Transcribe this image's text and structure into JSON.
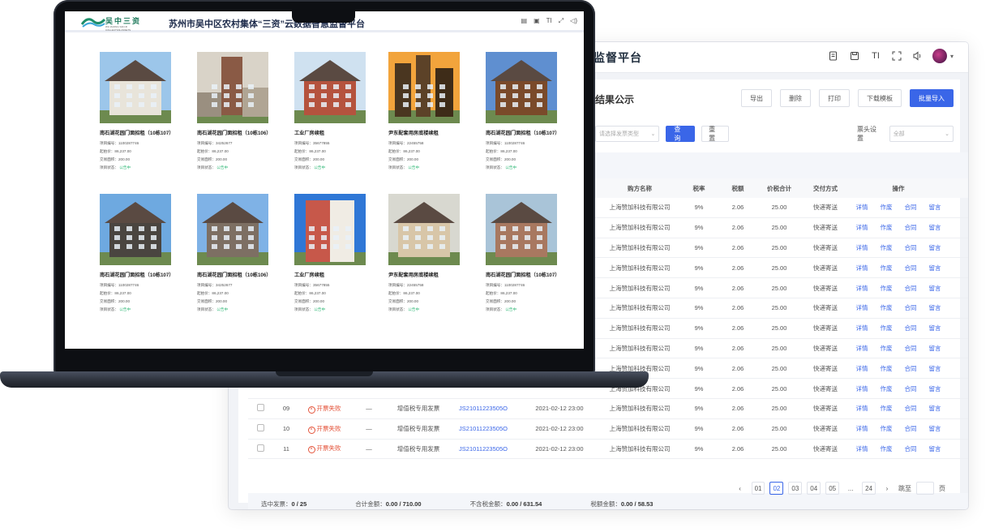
{
  "dashboard": {
    "title": "监督平台",
    "section_title": "结果公示",
    "toolbar": [
      "导出",
      "删除",
      "打印",
      "下载模板",
      "批量导入"
    ],
    "filter": {
      "select1_placeholder": "请选择发票类型",
      "query_label": "查询",
      "reset_label": "重置",
      "buyer_label": "票头设置",
      "buyer_placeholder": "全部"
    },
    "columns": [
      "",
      "",
      "",
      "",
      "",
      "",
      "",
      "购方名称",
      "税率",
      "税额",
      "价税合计",
      "交付方式",
      "操作"
    ],
    "rows": [
      {
        "no": "",
        "status": "",
        "type": "",
        "inv": "",
        "date": "",
        "buyer": "上海赞加科技有限公司",
        "rate": "9%",
        "tax": "2.06",
        "total": "25.00",
        "deliv": "快递寄送"
      },
      {
        "no": "",
        "status": "",
        "type": "",
        "inv": "",
        "date": "",
        "buyer": "上海赞加科技有限公司",
        "rate": "9%",
        "tax": "2.06",
        "total": "25.00",
        "deliv": "快递寄送"
      },
      {
        "no": "",
        "status": "",
        "type": "",
        "inv": "",
        "date": "",
        "buyer": "上海赞加科技有限公司",
        "rate": "9%",
        "tax": "2.06",
        "total": "25.00",
        "deliv": "快递寄送"
      },
      {
        "no": "",
        "status": "",
        "type": "",
        "inv": "",
        "date": "",
        "buyer": "上海赞加科技有限公司",
        "rate": "9%",
        "tax": "2.06",
        "total": "25.00",
        "deliv": "快递寄送"
      },
      {
        "no": "",
        "status": "",
        "type": "",
        "inv": "",
        "date": "",
        "buyer": "上海赞加科技有限公司",
        "rate": "9%",
        "tax": "2.06",
        "total": "25.00",
        "deliv": "快递寄送"
      },
      {
        "no": "",
        "status": "",
        "type": "",
        "inv": "",
        "date": "",
        "buyer": "上海赞加科技有限公司",
        "rate": "9%",
        "tax": "2.06",
        "total": "25.00",
        "deliv": "快递寄送"
      },
      {
        "no": "",
        "status": "",
        "type": "",
        "inv": "",
        "date": "",
        "buyer": "上海赞加科技有限公司",
        "rate": "9%",
        "tax": "2.06",
        "total": "25.00",
        "deliv": "快递寄送"
      },
      {
        "no": "",
        "status": "",
        "type": "",
        "inv": "",
        "date": "",
        "buyer": "上海赞加科技有限公司",
        "rate": "9%",
        "tax": "2.06",
        "total": "25.00",
        "deliv": "快递寄送"
      },
      {
        "no": "",
        "status": "",
        "type": "",
        "inv": "",
        "date": "",
        "buyer": "上海赞加科技有限公司",
        "rate": "9%",
        "tax": "2.06",
        "total": "25.00",
        "deliv": "快递寄送"
      },
      {
        "no": "",
        "status": "",
        "type": "",
        "inv": "",
        "date": "",
        "buyer": "上海赞加科技有限公司",
        "rate": "9%",
        "tax": "2.06",
        "total": "25.00",
        "deliv": "快递寄送"
      },
      {
        "no": "09",
        "status": "开票失败",
        "type": "增值税专用发票",
        "inv": "JS21011223505O",
        "date": "2021-02-12 23:00",
        "buyer": "上海赞加科技有限公司",
        "rate": "9%",
        "tax": "2.06",
        "total": "25.00",
        "deliv": "快递寄送"
      },
      {
        "no": "10",
        "status": "开票失败",
        "type": "增值税专用发票",
        "inv": "JS21011223505O",
        "date": "2021-02-12 23:00",
        "buyer": "上海赞加科技有限公司",
        "rate": "9%",
        "tax": "2.06",
        "total": "25.00",
        "deliv": "快递寄送"
      },
      {
        "no": "11",
        "status": "开票失败",
        "type": "增值税专用发票",
        "inv": "JS21011223505O",
        "date": "2021-02-12 23:00",
        "buyer": "上海赞加科技有限公司",
        "rate": "9%",
        "tax": "2.06",
        "total": "25.00",
        "deliv": "快递寄送"
      }
    ],
    "row_ops": [
      "详情",
      "作废",
      "合同",
      "留言"
    ],
    "summary": {
      "selected": "选中发票：",
      "selected_val": "0 / 25",
      "total": "合计金额：",
      "total_val": "0.00 / 710.00",
      "untaxed": "不含税金额：",
      "untaxed_val": "0.00 / 631.54",
      "tax": "税额金额：",
      "tax_val": "0.00 / 58.53"
    },
    "pager": {
      "pages": [
        "01",
        "02",
        "03",
        "04",
        "05",
        "...",
        "24"
      ],
      "active": "02",
      "goto": "跳至",
      "page_suffix": "页"
    }
  },
  "screen": {
    "logo_text": "吴中三资",
    "logo_sub": "WU ZHONG SAN ZI COLLECTIVE ASSETS",
    "title": "苏州市吴中区农村集体“三资”云数据智慧监督平台",
    "meta_labels": {
      "code": "项目编号：",
      "price": "起拍价：",
      "area": "交易面积：",
      "status": "项目状态："
    },
    "cards": [
      {
        "name": "南石湖花园门面招租（10栋107）",
        "code": "1100287746",
        "price": "86,237.00",
        "area": "200.00",
        "status": "公告中",
        "img": "white-villa"
      },
      {
        "name": "南石湖花园门面招租（10栋106）",
        "code": "34252677",
        "price": "86,237.00",
        "area": "200.00",
        "status": "公告中",
        "img": "brick-tower"
      },
      {
        "name": "工业厂房续租",
        "code": "35677855",
        "price": "86,237.00",
        "area": "200.00",
        "status": "公告中",
        "img": "red-house"
      },
      {
        "name": "尹东配套用房底楼续租",
        "code": "22455758",
        "price": "86,237.00",
        "area": "200.00",
        "status": "公告中",
        "img": "sunset-towers"
      },
      {
        "name": "南石湖花园门面招租（10栋107）",
        "code": "1100287746",
        "price": "86,237.00",
        "area": "200.00",
        "status": "公告中",
        "img": "wood-house"
      },
      {
        "name": "南石湖花园门面招租（10栋107）",
        "code": "1100287746",
        "price": "86,237.00",
        "area": "200.00",
        "status": "公告中",
        "img": "modern-house"
      },
      {
        "name": "南石湖花园门面招租（10栋106）",
        "code": "34252677",
        "price": "86,237.00",
        "area": "200.00",
        "status": "公告中",
        "img": "victorian-house"
      },
      {
        "name": "工业厂房续租",
        "code": "35677855",
        "price": "86,237.00",
        "area": "200.00",
        "status": "公告中",
        "img": "apartment"
      },
      {
        "name": "尹东配套用房底楼续租",
        "code": "22455758",
        "price": "86,237.00",
        "area": "200.00",
        "status": "公告中",
        "img": "classic-villa"
      },
      {
        "name": "南石湖花园门面招租（10栋107）",
        "code": "1100287746",
        "price": "86,237.00",
        "area": "200.00",
        "status": "公告中",
        "img": "stone-manor"
      }
    ]
  },
  "colors": {
    "accent": "#3a66e8",
    "status_green": "#2bb673",
    "status_fail": "#e4533a",
    "title": "#1c2a4a"
  }
}
